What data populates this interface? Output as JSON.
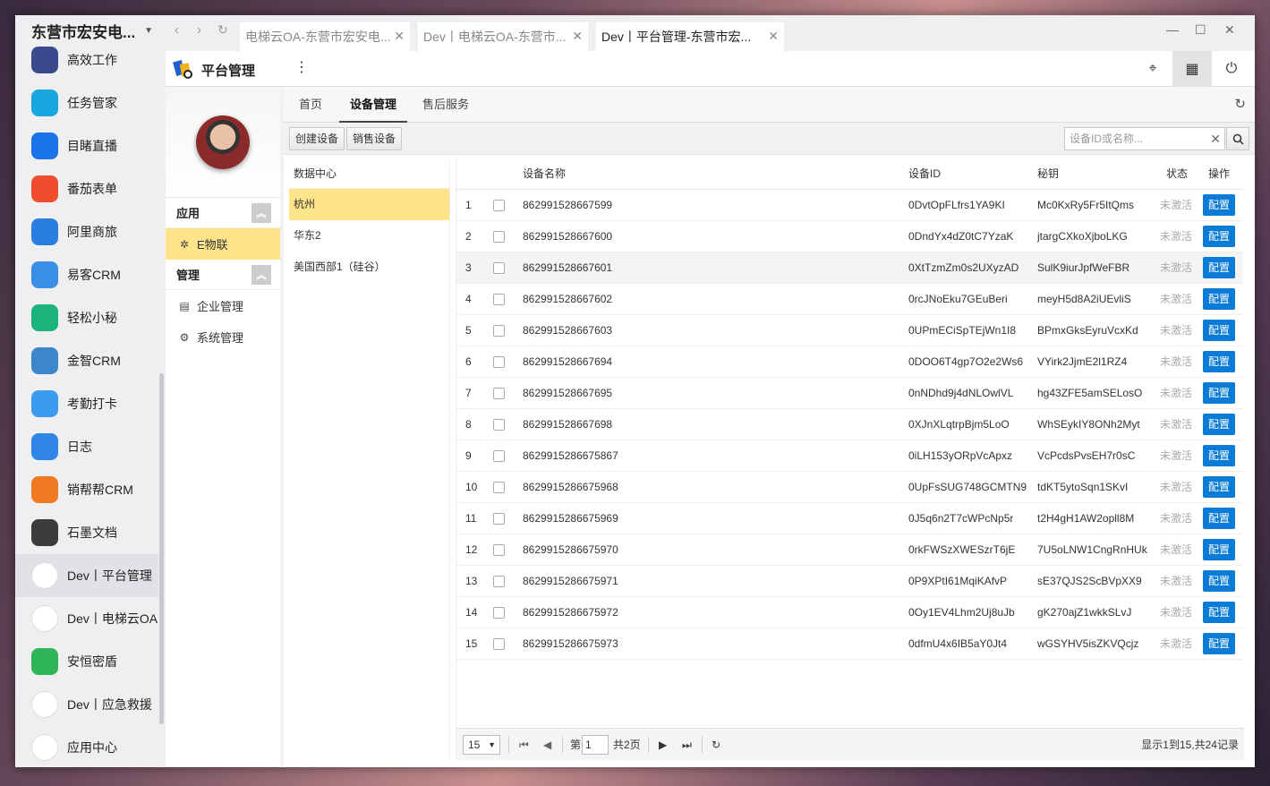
{
  "appbar": {
    "title": "东营市宏安电...",
    "items": [
      {
        "label": "高效工作",
        "icon": "star-icon",
        "color": "#3b4a8c"
      },
      {
        "label": "任务管家",
        "icon": "clock-icon",
        "color": "#1aa7e0"
      },
      {
        "label": "目睹直播",
        "icon": "play-icon",
        "color": "#1a73e8"
      },
      {
        "label": "番茄表单",
        "icon": "tomato-icon",
        "color": "#f04d2e"
      },
      {
        "label": "阿里商旅",
        "icon": "plane-icon",
        "color": "#2a7de1"
      },
      {
        "label": "易客CRM",
        "icon": "crm-icon",
        "color": "#3a8ee6"
      },
      {
        "label": "轻松小秘",
        "icon": "note-icon",
        "color": "#19b37b"
      },
      {
        "label": "金智CRM",
        "icon": "chart-icon",
        "color": "#3c86c9"
      },
      {
        "label": "考勤打卡",
        "icon": "location-icon",
        "color": "#3a9bf0"
      },
      {
        "label": "日志",
        "icon": "log-icon",
        "color": "#2f86e8"
      },
      {
        "label": "销帮帮CRM",
        "icon": "b-icon",
        "color": "#f07a22"
      },
      {
        "label": "石墨文档",
        "icon": "doc-icon",
        "color": "#3c3c3c"
      },
      {
        "label": "Dev丨平台管理",
        "icon": "platform-logo-icon",
        "color": "#ffffff"
      },
      {
        "label": "Dev丨电梯云OA",
        "icon": "elevator-logo-icon",
        "color": "#ffffff"
      },
      {
        "label": "安恒密盾",
        "icon": "lock-icon",
        "color": "#2fb55a"
      },
      {
        "label": "Dev丨应急救援",
        "icon": "rescue-24-icon",
        "color": "#ffffff"
      },
      {
        "label": "应用中心",
        "icon": "pinwheel-icon",
        "color": "#ffffff"
      }
    ]
  },
  "browser": {
    "tabs": [
      {
        "label": "电梯云OA-东营市宏安电..."
      },
      {
        "label": "Dev丨电梯云OA-东营市..."
      },
      {
        "label": "Dev丨平台管理-东营市宏..."
      }
    ]
  },
  "topbar": {
    "title": "平台管理",
    "more": "⋮"
  },
  "leftnav": {
    "sections": [
      {
        "title": "应用",
        "items": [
          {
            "label": "E物联",
            "icon": "iot-icon"
          }
        ]
      },
      {
        "title": "管理",
        "items": [
          {
            "label": "企业管理",
            "icon": "building-icon"
          },
          {
            "label": "系统管理",
            "icon": "settings-icon"
          }
        ]
      }
    ]
  },
  "main": {
    "tabs": [
      "首页",
      "设备管理",
      "售后服务"
    ],
    "active_tab": "设备管理",
    "toolbar": {
      "create": "创建设备",
      "sell": "销售设备",
      "search_placeholder": "设备ID或名称..."
    }
  },
  "datacenters": {
    "header": "数据中心",
    "items": [
      "杭州",
      "华东2",
      "美国西部1（硅谷）"
    ],
    "selected": "杭州"
  },
  "grid": {
    "columns": {
      "name": "设备名称",
      "id": "设备ID",
      "secret": "秘钥",
      "status": "状态",
      "action": "操作"
    },
    "rows": [
      {
        "no": "1",
        "name": "862991528667599",
        "id": "0DvtOpFLfrs1YA9KI",
        "secret": "Mc0KxRy5Fr5ItQms",
        "status": "未激活",
        "action": "配置"
      },
      {
        "no": "2",
        "name": "862991528667600",
        "id": "0DndYx4dZ0tC7YzaK",
        "secret": "jtargCXkoXjboLKG",
        "status": "未激活",
        "action": "配置"
      },
      {
        "no": "3",
        "name": "862991528667601",
        "id": "0XtTzmZm0s2UXyzAD",
        "secret": "SulK9iurJpfWeFBR",
        "status": "未激活",
        "action": "配置"
      },
      {
        "no": "4",
        "name": "862991528667602",
        "id": "0rcJNoEku7GEuBeri",
        "secret": "meyH5d8A2iUEvliS",
        "status": "未激活",
        "action": "配置"
      },
      {
        "no": "5",
        "name": "862991528667603",
        "id": "0UPmECiSpTEjWn1I8",
        "secret": "BPmxGksEyruVcxKd",
        "status": "未激活",
        "action": "配置"
      },
      {
        "no": "6",
        "name": "862991528667694",
        "id": "0DOO6T4gp7O2e2Ws6",
        "secret": "VYirk2JjmE2l1RZ4",
        "status": "未激活",
        "action": "配置"
      },
      {
        "no": "7",
        "name": "862991528667695",
        "id": "0nNDhd9j4dNLOwlVL",
        "secret": "hg43ZFE5amSELosO",
        "status": "未激活",
        "action": "配置"
      },
      {
        "no": "8",
        "name": "862991528667698",
        "id": "0XJnXLqtrpBjm5LoO",
        "secret": "WhSEykIY8ONh2Myt",
        "status": "未激活",
        "action": "配置"
      },
      {
        "no": "9",
        "name": "8629915286675867",
        "id": "0iLH153yORpVcApxz",
        "secret": "VcPcdsPvsEH7r0sC",
        "status": "未激活",
        "action": "配置"
      },
      {
        "no": "10",
        "name": "8629915286675968",
        "id": "0UpFsSUG748GCMTN9",
        "secret": "tdKT5ytoSqn1SKvI",
        "status": "未激活",
        "action": "配置"
      },
      {
        "no": "11",
        "name": "8629915286675969",
        "id": "0J5q6n2T7cWPcNp5r",
        "secret": "t2H4gH1AW2opll8M",
        "status": "未激活",
        "action": "配置"
      },
      {
        "no": "12",
        "name": "8629915286675970",
        "id": "0rkFWSzXWESzrT6jE",
        "secret": "7U5oLNW1CngRnHUk",
        "status": "未激活",
        "action": "配置"
      },
      {
        "no": "13",
        "name": "8629915286675971",
        "id": "0P9XPtI61MqiKAfvP",
        "secret": "sE37QJS2ScBVpXX9",
        "status": "未激活",
        "action": "配置"
      },
      {
        "no": "14",
        "name": "8629915286675972",
        "id": "0Oy1EV4Lhm2Uj8uJb",
        "secret": "gK270ajZ1wkkSLvJ",
        "status": "未激活",
        "action": "配置"
      },
      {
        "no": "15",
        "name": "8629915286675973",
        "id": "0dfmU4x6IB5aY0Jt4",
        "secret": "wGSYHV5isZKVQcjz",
        "status": "未激活",
        "action": "配置"
      }
    ]
  },
  "pager": {
    "page_size": "15",
    "page_prefix": "第",
    "page": "1",
    "total_pages": "共2页",
    "summary": "显示1到15,共24记录"
  }
}
